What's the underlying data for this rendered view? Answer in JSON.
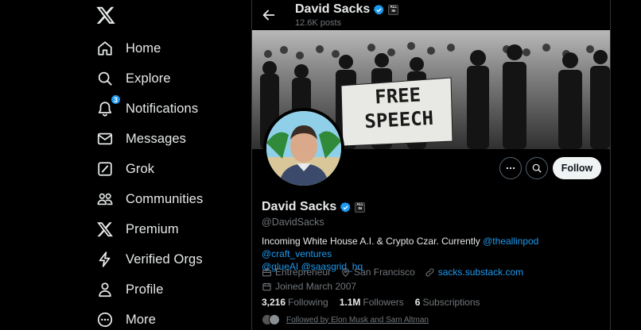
{
  "sidebar": {
    "items": [
      {
        "label": "Home",
        "icon": "home-icon"
      },
      {
        "label": "Explore",
        "icon": "search-icon"
      },
      {
        "label": "Notifications",
        "icon": "bell-icon",
        "badge": "3"
      },
      {
        "label": "Messages",
        "icon": "mail-icon"
      },
      {
        "label": "Grok",
        "icon": "grok-icon"
      },
      {
        "label": "Communities",
        "icon": "people-icon"
      },
      {
        "label": "Premium",
        "icon": "x-logo-icon"
      },
      {
        "label": "Verified Orgs",
        "icon": "lightning-icon"
      },
      {
        "label": "Profile",
        "icon": "person-icon"
      },
      {
        "label": "More",
        "icon": "more-circle-icon"
      }
    ]
  },
  "header": {
    "name": "David Sacks",
    "post_count": "12.6K posts"
  },
  "affiliation_badge": {
    "line1": "ALL",
    "line2": "IN"
  },
  "banner": {
    "sign_line1": "FREE",
    "sign_line2": "SPEECH"
  },
  "profile": {
    "name": "David Sacks",
    "handle": "@DavidSacks",
    "bio_text": "Incoming White House A.I. & Crypto Czar. Currently ",
    "bio_mentions": [
      "@theallinpod",
      "@craft_ventures",
      "@glueAI",
      "@saasgrid_hq"
    ],
    "occupation": "Entrepreneur",
    "location": "San Francisco",
    "website": "sacks.substack.com",
    "joined": "Joined March 2007",
    "following_count": "3,216",
    "following_label": "Following",
    "followers_count": "1.1M",
    "followers_label": "Followers",
    "subscriptions_count": "6",
    "subscriptions_label": "Subscriptions",
    "followed_by": "Followed by Elon Musk and Sam Altman"
  },
  "actions": {
    "follow_label": "Follow"
  },
  "colors": {
    "accent": "#1d9bf0",
    "background": "#000000",
    "text": "#e7e9ea",
    "muted": "#71767b"
  }
}
